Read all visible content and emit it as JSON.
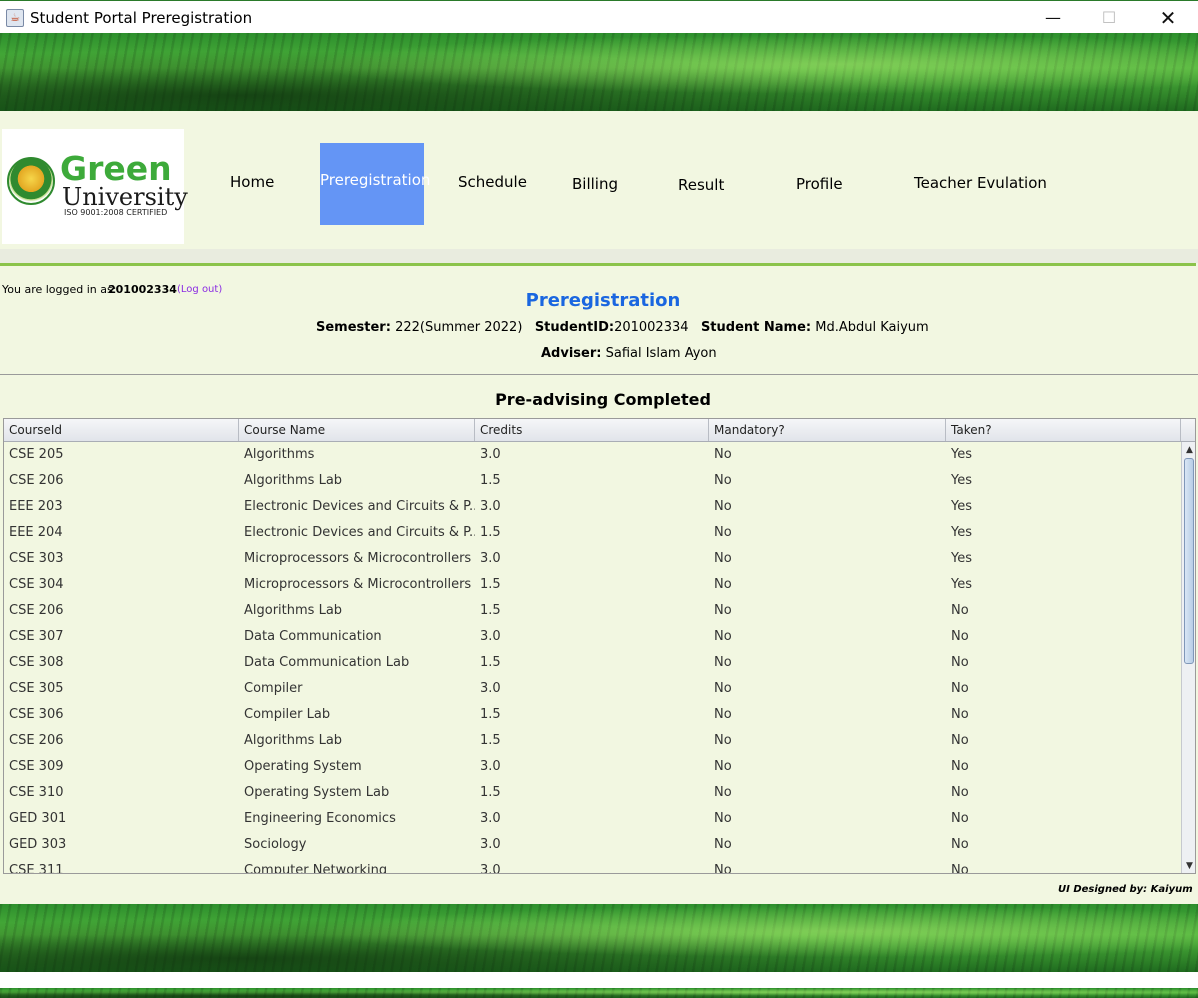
{
  "window": {
    "title": "Student Portal Preregistration",
    "icon": "java-icon",
    "minimize": "—",
    "maximize": "☐",
    "close": "✕"
  },
  "logo": {
    "line1": "Green",
    "line2": "University",
    "line3": "ISO 9001:2008 CERTIFIED"
  },
  "nav": {
    "home": "Home",
    "preregistration": "Preregistration",
    "schedule": "Schedule",
    "billing": "Billing",
    "result": "Result",
    "profile": "Profile",
    "teacher_evaluation": "Teacher Evulation",
    "active": "preregistration",
    "active_color": "#6495f5"
  },
  "session": {
    "label": "You are logged in as:",
    "user_id": "201002334",
    "logout": "(Log out)"
  },
  "page": {
    "title": "Preregistration",
    "semester_label": "Semester:",
    "semester_value": "222(Summer 2022)",
    "student_id_label": "StudentID:",
    "student_id_value": "201002334",
    "student_name_label": "Student Name:",
    "student_name_value": "Md.Abdul Kaiyum",
    "adviser_label": "Adviser:",
    "adviser_value": "Safial Islam Ayon",
    "status": "Pre-advising Completed"
  },
  "table": {
    "columns": [
      "CourseId",
      "Course Name",
      "Credits",
      "Mandatory?",
      "Taken?"
    ],
    "rows": [
      [
        "CSE 205",
        "Algorithms",
        "3.0",
        "No",
        "Yes"
      ],
      [
        "CSE 206",
        "Algorithms Lab",
        "1.5",
        "No",
        "Yes"
      ],
      [
        "EEE 203",
        "Electronic Devices and Circuits & P...",
        "3.0",
        "No",
        "Yes"
      ],
      [
        "EEE 204",
        "Electronic Devices and Circuits & P...",
        "1.5",
        "No",
        "Yes"
      ],
      [
        "CSE 303",
        "Microprocessors & Microcontrollers",
        "3.0",
        "No",
        "Yes"
      ],
      [
        "CSE 304",
        "Microprocessors & Microcontrollers ...",
        "1.5",
        "No",
        "Yes"
      ],
      [
        "CSE 206",
        "Algorithms Lab",
        "1.5",
        "No",
        "No"
      ],
      [
        "CSE 307",
        "Data Communication",
        "3.0",
        "No",
        "No"
      ],
      [
        "CSE 308",
        "Data Communication Lab",
        "1.5",
        "No",
        "No"
      ],
      [
        "CSE 305",
        "Compiler",
        "3.0",
        "No",
        "No"
      ],
      [
        "CSE 306",
        "Compiler Lab",
        "1.5",
        "No",
        "No"
      ],
      [
        "CSE 206",
        "Algorithms Lab",
        "1.5",
        "No",
        "No"
      ],
      [
        "CSE 309",
        "Operating System",
        "3.0",
        "No",
        "No"
      ],
      [
        "CSE 310",
        "Operating System Lab",
        "1.5",
        "No",
        "No"
      ],
      [
        "GED 301",
        "Engineering Economics",
        "3.0",
        "No",
        "No"
      ],
      [
        "GED 303",
        "Sociology",
        "3.0",
        "No",
        "No"
      ],
      [
        "CSE 311",
        "Computer Networking",
        "3.0",
        "No",
        "No"
      ]
    ],
    "scroll_up": "▲",
    "scroll_down": "▼"
  },
  "footer": {
    "credit": "UI Designed by: Kaiyum"
  }
}
